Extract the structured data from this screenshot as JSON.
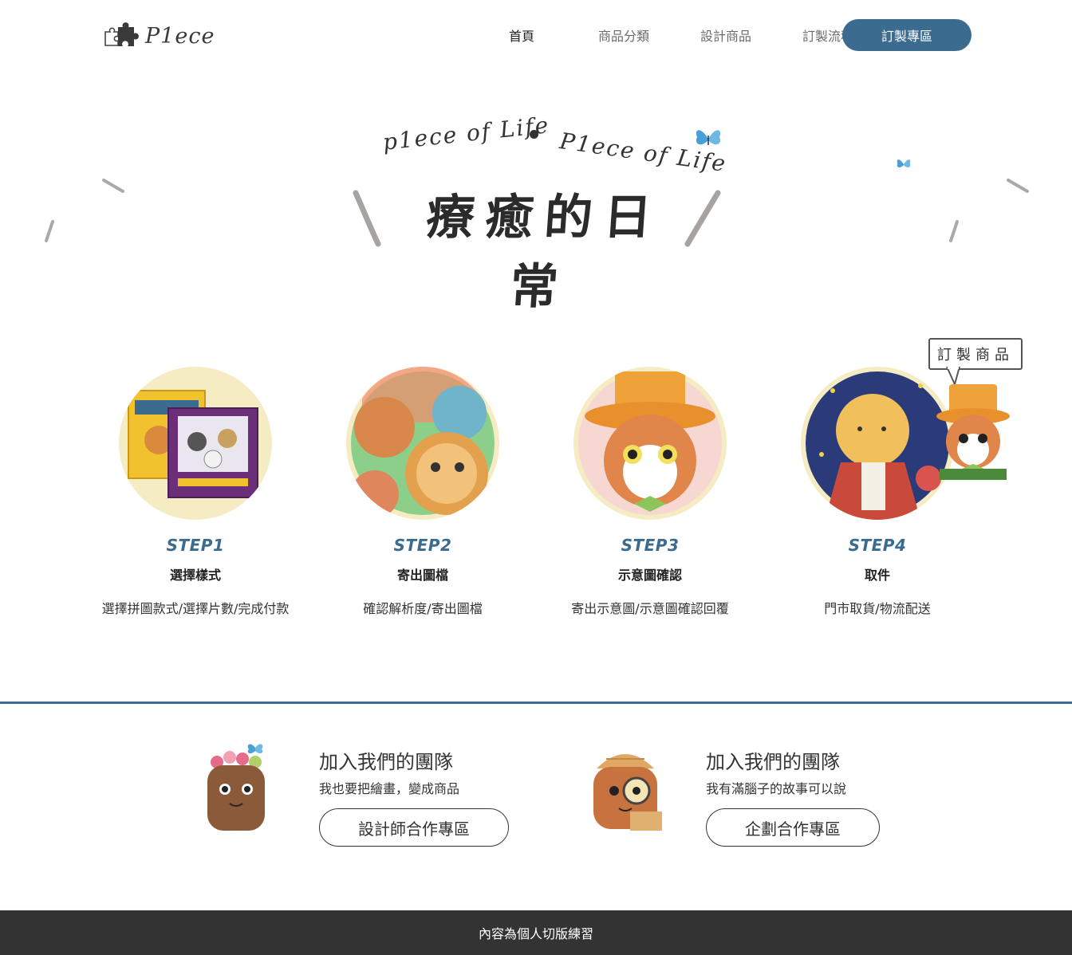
{
  "header": {
    "logo_text": "P1ece",
    "nav": [
      {
        "label": "首頁",
        "active": true
      },
      {
        "label": "商品分類",
        "active": false
      },
      {
        "label": "設計商品",
        "active": false
      },
      {
        "label": "訂製流程",
        "active": false
      }
    ],
    "cta_label": "訂製專區"
  },
  "hero": {
    "tagline_left": "p1ece of Life",
    "tagline_right": "P1ece of Life",
    "title": "療癒的日常"
  },
  "steps": [
    {
      "label": "STEP1",
      "title": "選擇樣式",
      "desc": "選擇拼圖款式/選擇片數/完成付款"
    },
    {
      "label": "STEP2",
      "title": "寄出圖檔",
      "desc": "確認解析度/寄出圖檔"
    },
    {
      "label": "STEP3",
      "title": "示意圖確認",
      "desc": "寄出示意圖/示意圖確認回覆"
    },
    {
      "label": "STEP4",
      "title": "取件",
      "desc": "門市取貨/物流配送"
    }
  ],
  "custom_bubble": "訂製商品",
  "join": [
    {
      "title": "加入我們的團隊",
      "subtitle": "我也要把繪畫，變成商品",
      "button": "設計師合作專區"
    },
    {
      "title": "加入我們的團隊",
      "subtitle": "我有滿腦子的故事可以說",
      "button": "企劃合作專區"
    }
  ],
  "footer": {
    "text": "內容為個人切版練習"
  },
  "colors": {
    "accent": "#3b6b8f",
    "circle_bg": "#f6ecc4",
    "footer_bg": "#333333"
  }
}
